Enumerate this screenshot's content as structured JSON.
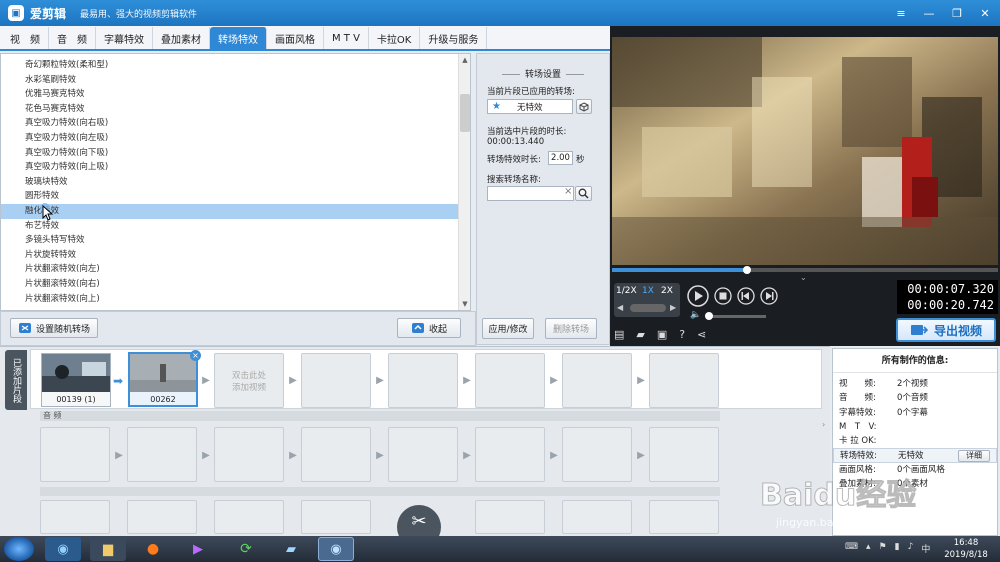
{
  "app": {
    "title": "爱剪辑",
    "slogan": "最易用、强大的视频剪辑软件",
    "logo_icon": "app-logo-icon"
  },
  "window_controls": {
    "menu": "≡",
    "minimize": "—",
    "restore": "❐",
    "close": "✕"
  },
  "tabs": [
    {
      "label": "视　频"
    },
    {
      "label": "音　频"
    },
    {
      "label": "字幕特效"
    },
    {
      "label": "叠加素材"
    },
    {
      "label": "转场特效",
      "active": true
    },
    {
      "label": "画面风格"
    },
    {
      "label": "M T V"
    },
    {
      "label": "卡拉OK"
    },
    {
      "label": "升级与服务"
    }
  ],
  "transition_list": [
    "奇幻颗粒特效(柔和型)",
    "水彩笔刷特效",
    "优雅马赛克特效",
    "花色马赛克特效",
    "真空吸力特效(向右吸)",
    "真空吸力特效(向左吸)",
    "真空吸力特效(向下吸)",
    "真空吸力特效(向上吸)",
    "玻璃块特效",
    "圆形特效",
    "融化特效",
    "布艺特效",
    "多镜头特写特效",
    "片状旋转特效",
    "片状翻滚特效(向左)",
    "片状翻滚特效(向右)",
    "片状翻滚特效(向上)"
  ],
  "selected_index": 10,
  "list_buttons": {
    "random": "设置随机转场",
    "collect": "收起"
  },
  "settings": {
    "header": "转场设置",
    "applied_label": "当前片段已应用的转场:",
    "applied_value": "无特效",
    "duration_label": "当前选中片段的时长:",
    "duration_value": "00:00:13.440",
    "effect_duration_label": "转场特效时长:",
    "effect_duration_value": "2.00",
    "effect_duration_unit": "秒",
    "search_label": "搜索转场名称:",
    "search_value": "",
    "apply_button": "应用/修改",
    "delete_button": "删除转场"
  },
  "player": {
    "speeds": [
      "1/2X",
      "1X",
      "2X"
    ],
    "current_time": "00:00:07.320",
    "total_time": "00:00:20.742",
    "export_label": "导出视频",
    "progress": 0.35,
    "volume": 0.05
  },
  "timeline": {
    "side_label": "已添加片段",
    "clips": [
      {
        "label": "00139 (1)"
      },
      {
        "label": "00262"
      }
    ],
    "add_hint_1": "双击此处",
    "add_hint_2": "添加视频",
    "audio_label": "音 频"
  },
  "info_panel": {
    "title": "所有制作的信息:",
    "rows": [
      {
        "k": "视　　频:",
        "v": "2个视频"
      },
      {
        "k": "音　　频:",
        "v": "0个音频"
      },
      {
        "k": "字幕特效:",
        "v": "0个字幕"
      },
      {
        "k": "M　T　V:",
        "v": ""
      },
      {
        "k": "卡 拉 OK:",
        "v": ""
      },
      {
        "k": "转场特效:",
        "v": "无特效"
      },
      {
        "k": "画面风格:",
        "v": "0个画面风格"
      },
      {
        "k": "叠加素材:",
        "v": "0个素材"
      }
    ],
    "detail_button": "详细"
  },
  "taskbar": {
    "time": "16:48",
    "date": "2019/8/18"
  },
  "watermark": {
    "brand": "Baidu经验",
    "url": "jingyan.baidu.com"
  }
}
